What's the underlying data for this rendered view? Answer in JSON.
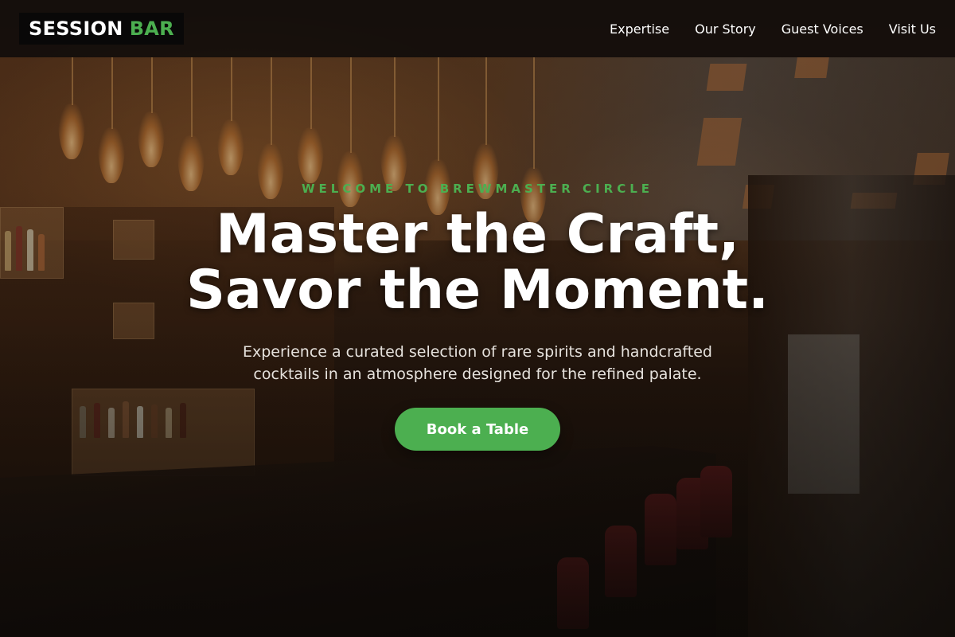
{
  "brand": {
    "name_part1": "SESSION",
    "name_part2": "BAR",
    "accent_color": "#4caf50"
  },
  "nav": {
    "items": [
      {
        "label": "Expertise"
      },
      {
        "label": "Our Story"
      },
      {
        "label": "Guest Voices"
      },
      {
        "label": "Visit Us"
      }
    ]
  },
  "hero": {
    "eyebrow": "WELCOME TO BREWMASTER CIRCLE",
    "headline_line1": "Master the Craft,",
    "headline_line2": "Savor the Moment.",
    "subtitle": "Experience a curated selection of rare spirits and handcrafted cocktails in an atmosphere designed for the refined palate.",
    "cta_label": "Book a Table",
    "background_image": "bar-interior-photo"
  }
}
